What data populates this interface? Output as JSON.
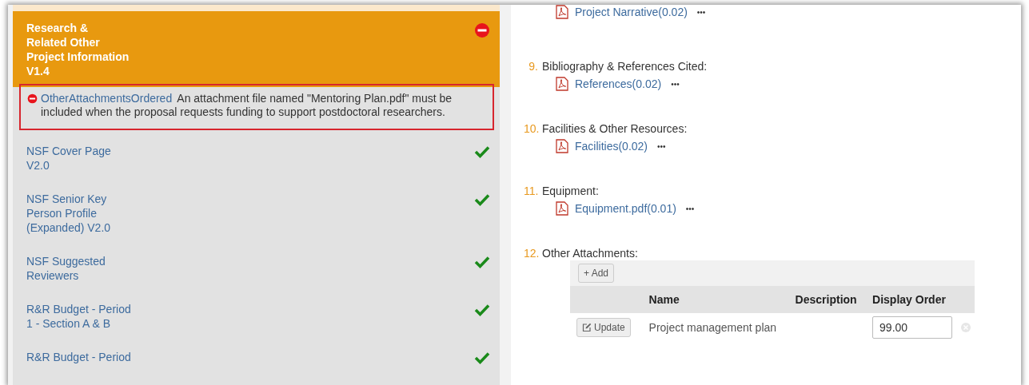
{
  "sidebar": {
    "items": [
      {
        "lines": [
          "Research &",
          "Related Other",
          "Project Information",
          "V1.4"
        ],
        "valid": false,
        "selected": true,
        "errors": [
          {
            "rule": "OtherAttachmentsOrdered",
            "message": "An attachment file named \"Mentoring Plan.pdf\" must be included when the proposal requests funding to support postdoctoral researchers."
          }
        ]
      },
      {
        "lines": [
          "NSF Cover Page",
          "V2.0"
        ],
        "valid": true,
        "selected": false
      },
      {
        "lines": [
          "NSF Senior Key",
          "Person Profile",
          "(Expanded) V2.0"
        ],
        "valid": true,
        "selected": false
      },
      {
        "lines": [
          "NSF Suggested",
          "Reviewers"
        ],
        "valid": true,
        "selected": false
      },
      {
        "lines": [
          "R&R Budget - Period",
          "1 - Section A & B"
        ],
        "valid": true,
        "selected": false
      },
      {
        "lines": [
          "R&R Budget - Period"
        ],
        "valid": true,
        "selected": false
      }
    ]
  },
  "sections": [
    {
      "attachments": [
        {
          "name": "Project Narrative(0.02)",
          "more": "•••"
        }
      ]
    },
    {
      "number": "9.",
      "label": "Bibliography & References Cited:",
      "attachments": [
        {
          "name": "References(0.02)",
          "more": "•••"
        }
      ]
    },
    {
      "number": "10.",
      "label": "Facilities & Other Resources:",
      "attachments": [
        {
          "name": "Facilities(0.02)",
          "more": "•••"
        }
      ]
    },
    {
      "number": "11.",
      "label": "Equipment:",
      "attachments": [
        {
          "name": "Equipment.pdf(0.01)",
          "more": "•••"
        }
      ]
    },
    {
      "number": "12.",
      "label": "Other Attachments:",
      "table": {
        "add": "+ Add",
        "columns": [
          "Name",
          "Description",
          "Display Order"
        ],
        "rows": [
          {
            "action": "Update",
            "name": "Project management plan",
            "order": "99.00"
          }
        ]
      }
    }
  ]
}
